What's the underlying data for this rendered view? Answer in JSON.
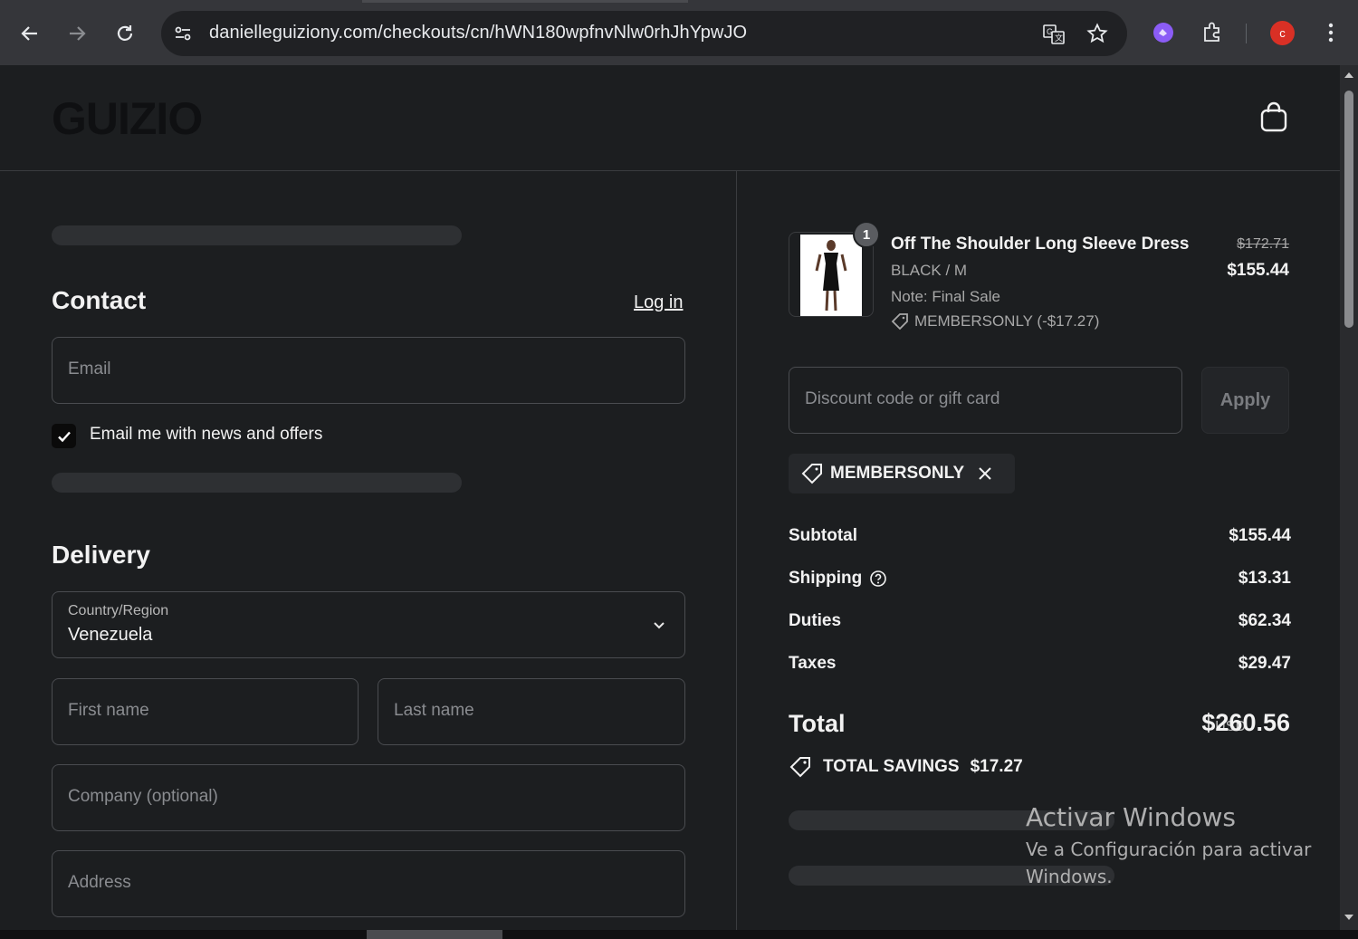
{
  "browser": {
    "url": "danielleguiziony.com/checkouts/cn/hWN180wpfnvNlw0rhJhYpwJO",
    "avatar_letter": "c"
  },
  "header": {
    "logo": "GUIZIO"
  },
  "contact": {
    "title": "Contact",
    "login_label": "Log in",
    "email_placeholder": "Email",
    "newsletter_label": "Email me with news and offers",
    "newsletter_checked": true
  },
  "delivery": {
    "title": "Delivery",
    "country_label": "Country/Region",
    "country_value": "Venezuela",
    "first_name_placeholder": "First name",
    "last_name_placeholder": "Last name",
    "company_placeholder": "Company (optional)",
    "address_placeholder": "Address"
  },
  "order": {
    "item": {
      "quantity": "1",
      "name": "Off The Shoulder Long Sleeve Dress",
      "variant": "BLACK / M",
      "note": "Note: Final Sale",
      "discount_line": "MEMBERSONLY (-$17.27)",
      "original_price": "$172.71",
      "price": "$155.44"
    },
    "discount_placeholder": "Discount code or gift card",
    "apply_label": "Apply",
    "applied_code": "MEMBERSONLY",
    "summary": {
      "subtotal_label": "Subtotal",
      "subtotal_value": "$155.44",
      "shipping_label": "Shipping",
      "shipping_value": "$13.31",
      "duties_label": "Duties",
      "duties_value": "$62.34",
      "taxes_label": "Taxes",
      "taxes_value": "$29.47",
      "total_label": "Total",
      "total_currency": "USD",
      "total_value": "$260.56",
      "savings_label": "TOTAL SAVINGS",
      "savings_value": "$17.27"
    }
  },
  "watermark": {
    "line1": "Activar Windows",
    "line2": "Ve a Configuración para activar Windows."
  },
  "colors": {
    "page_bg": "#1c1e20",
    "chrome_bg": "#35363a",
    "avatar": "#d93025",
    "text": "#f2f2f2"
  }
}
